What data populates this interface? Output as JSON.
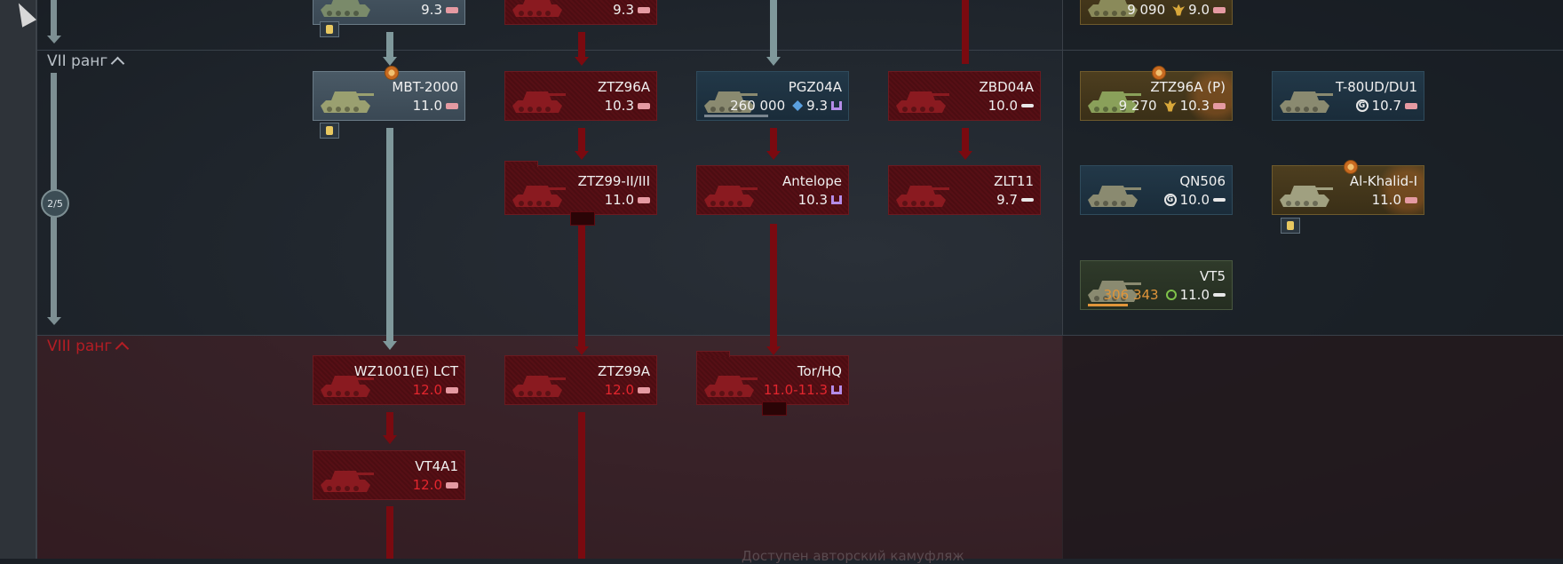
{
  "ranks": {
    "vii": {
      "label": "VII ранг"
    },
    "viii": {
      "label": "VIII ранг"
    }
  },
  "progress": {
    "label": "2/5"
  },
  "footer": {
    "text": "Доступен авторский камуфляж"
  },
  "vehicles": {
    "prev_c1": {
      "br": "9.3"
    },
    "prev_c2": {
      "br": "9.3"
    },
    "prev_prem1": {
      "cost": "9 090",
      "br": "9.0"
    },
    "mbt2000": {
      "name": "MBT-2000",
      "br": "11.0"
    },
    "ztz96a": {
      "name": "ZTZ96A",
      "br": "10.3"
    },
    "pgz04a": {
      "name": "PGZ04A",
      "cost": "260 000",
      "br": "9.3",
      "progress": 0.65
    },
    "zbd04a": {
      "name": "ZBD04A",
      "br": "10.0"
    },
    "ztz96ap": {
      "name": "ZTZ96A (P)",
      "cost": "9 270",
      "br": "10.3"
    },
    "t80ud": {
      "name": "T-80UD/DU1",
      "br": "10.7"
    },
    "ztz99": {
      "name": "ZTZ99-II/III",
      "br": "11.0"
    },
    "antelope": {
      "name": "Antelope",
      "br": "10.3"
    },
    "zlt11": {
      "name": "ZLT11",
      "br": "9.7"
    },
    "qn506": {
      "name": "QN506",
      "br": "10.0"
    },
    "alkhalid": {
      "name": "Al-Khalid-I",
      "br": "11.0"
    },
    "vt5": {
      "name": "VT5",
      "cost": "306 343",
      "br": "11.0",
      "progress": 0.3
    },
    "wz1001": {
      "name": "WZ1001(E) LCT",
      "br": "12.0"
    },
    "ztz99a": {
      "name": "ZTZ99A",
      "br": "12.0"
    },
    "torhq": {
      "name": "Tor/HQ",
      "br": "11.0-11.3"
    },
    "vt4a1": {
      "name": "VT4A1",
      "br": "12.0"
    }
  },
  "icons": {
    "gun": "tank-gun-icon",
    "aa": "anti-air-icon",
    "ge": "golden-eagle-icon",
    "rp": "research-points-icon",
    "sl": "silver-lions-icon",
    "gift": "gift-vehicle-icon"
  },
  "colors": {
    "locked_red": "#e3262e",
    "cost_orange": "#e0953a",
    "connector_grey": "#7f989b",
    "connector_red": "#7a0a10"
  }
}
